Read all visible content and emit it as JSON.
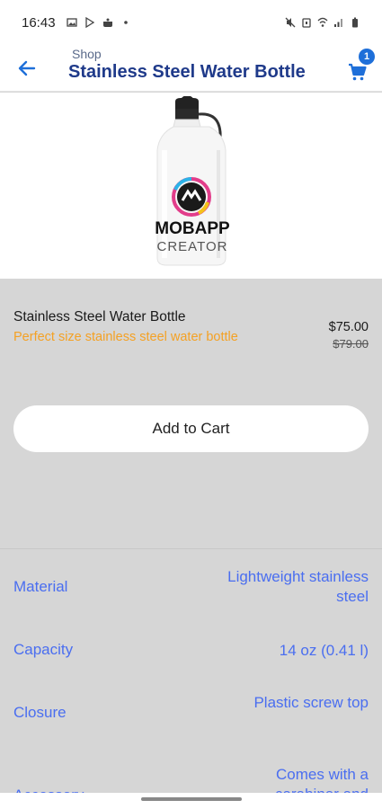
{
  "status_bar": {
    "time": "16:43"
  },
  "app_bar": {
    "breadcrumb": "Shop",
    "title": "Stainless Steel Water Bottle",
    "cart_count": "1"
  },
  "product_image": {
    "logo_line1": "MOBAPP",
    "logo_line2": "CREATOR"
  },
  "product": {
    "name": "Stainless Steel Water Bottle",
    "tagline": "Perfect size stainless steel water bottle",
    "price": "$75.00",
    "old_price": "$79.00",
    "add_to_cart_label": "Add to Cart"
  },
  "specs": [
    {
      "label": "Material",
      "value": "Lightweight stainless steel"
    },
    {
      "label": "Capacity",
      "value": "14 oz (0.41 l)"
    },
    {
      "label": "Closure",
      "value": "Plastic screw top"
    },
    {
      "label": "Accessory",
      "value": "Comes with a carabiner and"
    }
  ],
  "colors": {
    "title": "#1f3a8a",
    "accent_orange": "#f4a124",
    "spec_blue": "#4a6ef0",
    "badge_blue": "#1e6fd9"
  }
}
